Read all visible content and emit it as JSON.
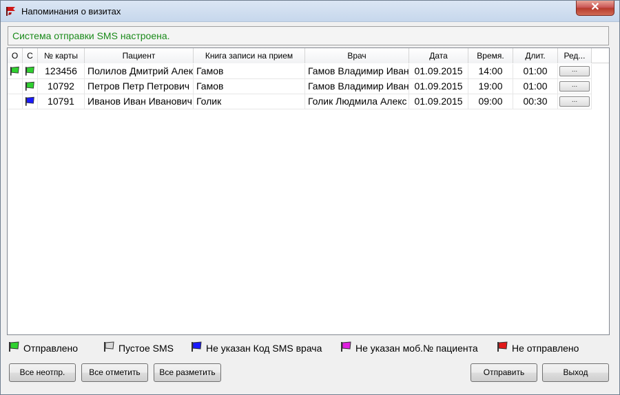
{
  "window": {
    "title": "Напоминания о визитах",
    "close_label": "✕"
  },
  "status": {
    "text": "Система отправки SMS настроена."
  },
  "grid": {
    "columns": [
      "О",
      "С",
      "№ карты",
      "Пациент",
      "Книга записи на прием",
      "Врач",
      "Дата",
      "Время.",
      "Длит.",
      "Ред..."
    ],
    "rows": [
      {
        "o": "green",
        "c": "green",
        "card": "123456",
        "patient": "Полилов Дмитрий Алек",
        "book": "Гамов",
        "doctor": "Гамов Владимир Иван",
        "date": "01.09.2015",
        "time": "14:00",
        "dur": "01:00",
        "edit": "..."
      },
      {
        "o": "",
        "c": "green",
        "card": "10792",
        "patient": "Петров Петр Петрович",
        "book": "Гамов",
        "doctor": "Гамов Владимир Иван",
        "date": "01.09.2015",
        "time": "19:00",
        "dur": "01:00",
        "edit": "..."
      },
      {
        "o": "",
        "c": "blue",
        "card": "10791",
        "patient": "Иванов Иван Иванович",
        "book": "Голик",
        "doctor": "Голик Людмила Алекс",
        "date": "01.09.2015",
        "time": "09:00",
        "dur": "00:30",
        "edit": "..."
      }
    ]
  },
  "legend": [
    {
      "label": "Отправлено",
      "color": "#2fd12f",
      "icon": "flag-icon-green"
    },
    {
      "label": "Пустое SMS",
      "color": "#d8d8d8",
      "icon": "flag-icon-gray"
    },
    {
      "label": "Не указан Код SMS врача",
      "color": "#1a1aff",
      "icon": "flag-icon-blue"
    },
    {
      "label": "Не указан моб.№ пациента",
      "color": "#e020e0",
      "icon": "flag-icon-magenta"
    },
    {
      "label": "Не отправлено",
      "color": "#e01818",
      "icon": "flag-icon-red"
    }
  ],
  "buttons": {
    "uncheck_all": "Все неотпр.",
    "check_all": "Все отметить",
    "unmark_all": "Все разметить",
    "send": "Отправить",
    "exit": "Выход"
  },
  "colors": {
    "green": "#2fd12f",
    "blue": "#1a1aff",
    "status_text": "#1a8a1a"
  }
}
